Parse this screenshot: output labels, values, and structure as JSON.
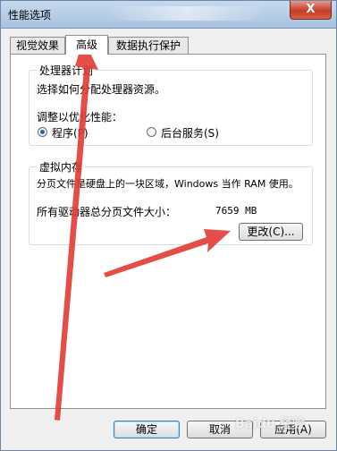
{
  "window": {
    "title": "性能选项",
    "close_glyph": "X"
  },
  "tabs": [
    {
      "label": "视觉效果",
      "active": false
    },
    {
      "label": "高级",
      "active": true
    },
    {
      "label": "数据执行保护",
      "active": false
    }
  ],
  "processor": {
    "group_title": "处理器计划",
    "description": "选择如何分配处理器资源。",
    "adjust_label": "调整以优化性能：",
    "options": [
      {
        "label": "程序(P)",
        "selected": true
      },
      {
        "label": "后台服务(S)",
        "selected": false
      }
    ]
  },
  "virtual_memory": {
    "group_title": "虚拟内存",
    "description": "分页文件是硬盘上的一块区域，Windows 当作 RAM 使用。",
    "total_label": "所有驱动器总分页文件大小：",
    "total_value": "7659 MB",
    "change_button": "更改(C)..."
  },
  "footer": {
    "ok": "确定",
    "cancel": "取消",
    "apply": "应用(A)"
  },
  "watermark": "Baidu 经验",
  "colors": {
    "arrow": "#e23b32",
    "title_bar": "#b9cfe8",
    "close": "#c9432e"
  }
}
